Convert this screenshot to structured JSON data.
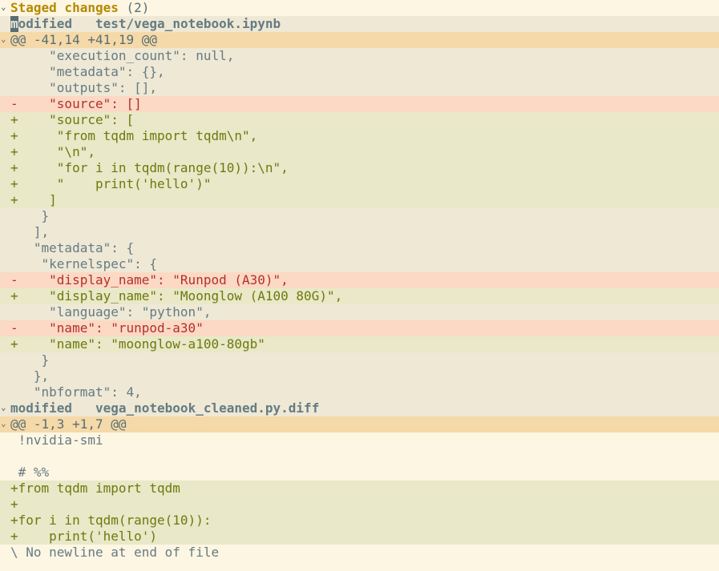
{
  "section": {
    "title": "Staged changes",
    "count": "(2)"
  },
  "files": [
    {
      "status": "modified",
      "path": "test/vega_notebook.ipynb",
      "hunk": "@@ -41,14 +41,19 @@",
      "lines": [
        {
          "type": "ctx",
          "text": "     \"execution_count\": null,"
        },
        {
          "type": "ctx",
          "text": "     \"metadata\": {},"
        },
        {
          "type": "ctx",
          "text": "     \"outputs\": [],"
        },
        {
          "type": "del",
          "text": "-    \"source\": []"
        },
        {
          "type": "add",
          "text": "+    \"source\": ["
        },
        {
          "type": "add",
          "text": "+     \"from tqdm import tqdm\\n\","
        },
        {
          "type": "add",
          "text": "+     \"\\n\","
        },
        {
          "type": "add",
          "text": "+     \"for i in tqdm(range(10)):\\n\","
        },
        {
          "type": "add",
          "text": "+     \"    print('hello')\""
        },
        {
          "type": "add",
          "text": "+    ]"
        },
        {
          "type": "ctx",
          "text": "    }"
        },
        {
          "type": "ctx",
          "text": "   ],"
        },
        {
          "type": "ctx",
          "text": "   \"metadata\": {"
        },
        {
          "type": "ctx",
          "text": "    \"kernelspec\": {"
        },
        {
          "type": "del",
          "text": "-    \"display_name\": \"Runpod (A30)\","
        },
        {
          "type": "add",
          "text": "+    \"display_name\": \"Moonglow (A100 80G)\","
        },
        {
          "type": "ctx",
          "text": "     \"language\": \"python\","
        },
        {
          "type": "del",
          "text": "-    \"name\": \"runpod-a30\""
        },
        {
          "type": "add",
          "text": "+    \"name\": \"moonglow-a100-80gb\""
        },
        {
          "type": "ctx",
          "text": "    }"
        },
        {
          "type": "ctx",
          "text": "   },"
        },
        {
          "type": "ctx",
          "text": "   \"nbformat\": 4,"
        }
      ]
    },
    {
      "status": "modified",
      "path": "vega_notebook_cleaned.py.diff",
      "hunk": "@@ -1,3 +1,7 @@",
      "lines": [
        {
          "type": "plain",
          "text": " !nvidia-smi"
        },
        {
          "type": "plain",
          "text": ""
        },
        {
          "type": "plain",
          "text": " # %%"
        },
        {
          "type": "add",
          "text": "+from tqdm import tqdm"
        },
        {
          "type": "add",
          "text": "+"
        },
        {
          "type": "add",
          "text": "+for i in tqdm(range(10)):"
        },
        {
          "type": "add",
          "text": "+    print('hello')"
        },
        {
          "type": "plain",
          "text": "\\ No newline at end of file"
        }
      ]
    }
  ],
  "colors": {
    "background": "#fdf6e3",
    "section_heading": "#b58900",
    "hunk_header_bg": "#f5d9a8",
    "removed_bg": "#fbd9c4",
    "removed_fg": "#b3302c",
    "added_bg": "#e9e8c8",
    "added_fg": "#6b7a0e",
    "context_bg": "#eee8d5"
  },
  "icons": {
    "fold": "chevron-down-icon"
  }
}
